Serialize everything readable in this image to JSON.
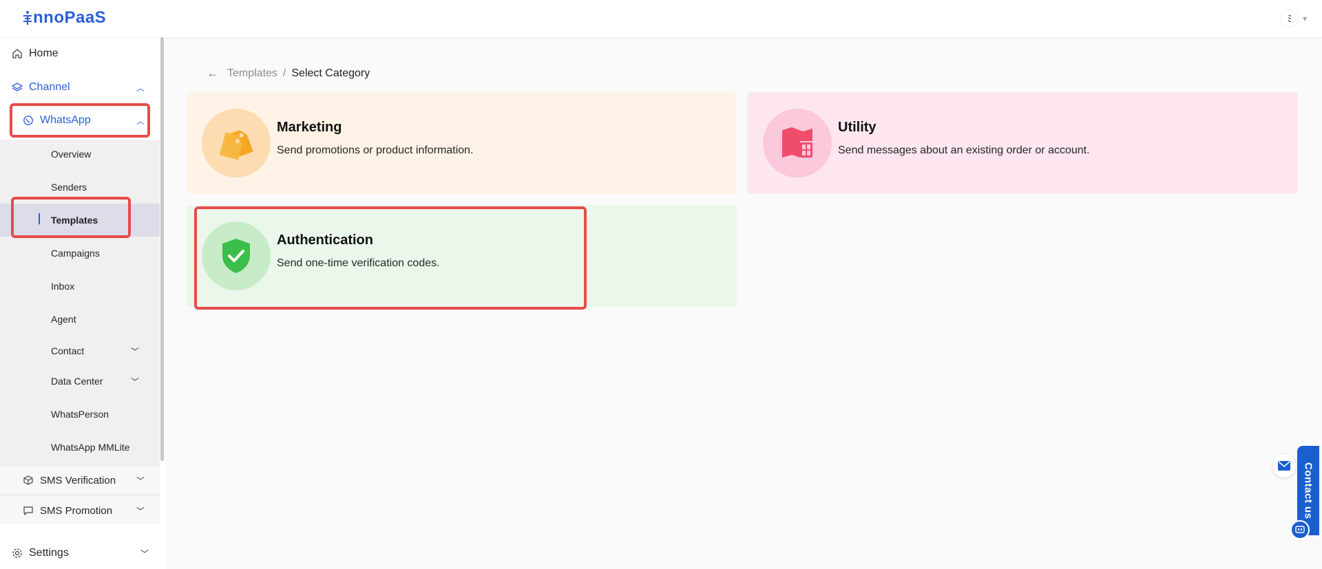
{
  "app": {
    "logo_text": "nnoPaaS",
    "user_initial": "ﾐ"
  },
  "sidebar": {
    "home": "Home",
    "channel": "Channel",
    "whatsapp": "WhatsApp",
    "whatsapp_items": [
      "Overview",
      "Senders",
      "Templates",
      "Campaigns",
      "Inbox",
      "Agent",
      "Contact",
      "Data Center",
      "WhatsPerson",
      "WhatsApp MMLite"
    ],
    "sms_verification": "SMS Verification",
    "sms_promotion": "SMS Promotion",
    "settings": "Settings"
  },
  "breadcrumb": {
    "parent": "Templates",
    "separator": "/",
    "current": "Select Category"
  },
  "categories": [
    {
      "title": "Marketing",
      "description": "Send promotions or product information.",
      "bg": "#fef3e6",
      "circle": "#fcdcb0",
      "accent": "#f5a623",
      "icon": "tag-icon"
    },
    {
      "title": "Utility",
      "description": "Send messages about an existing order or account.",
      "bg": "#fde6f0",
      "circle": "#fbc8dc",
      "accent": "#ef4d6b",
      "icon": "map-icon"
    },
    {
      "title": "Authentication",
      "description": "Send one-time verification codes.",
      "bg": "#ecf7ec",
      "circle": "#c8ecc8",
      "accent": "#3bbf4a",
      "icon": "shield-check-icon"
    }
  ],
  "contact": {
    "label": "Contact us"
  },
  "colors": {
    "brand": "#2b5fd9",
    "highlight": "#e84a4a"
  }
}
